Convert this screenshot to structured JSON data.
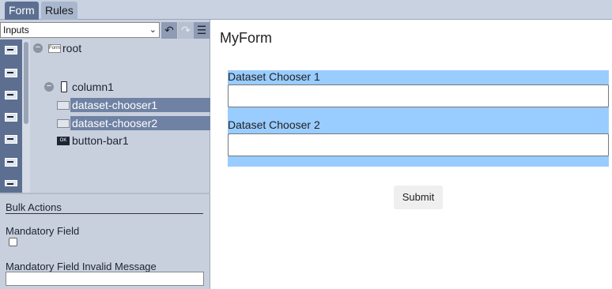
{
  "tabs": [
    {
      "label": "Form",
      "active": true
    },
    {
      "label": "Rules",
      "active": false
    }
  ],
  "left_panel": {
    "select": {
      "value": "Inputs",
      "options": [
        "Inputs"
      ]
    },
    "toolbar_icons": [
      "undo-icon",
      "redo-icon",
      "menu-icon"
    ],
    "palette_icons": [
      "input-icon",
      "input-icon",
      "dataset-chooser-icon",
      "textarea-icon",
      "dropdown-icon",
      "select-icon",
      "button-icon"
    ],
    "tree": {
      "root": {
        "label": "root",
        "icon": "Form"
      },
      "column": {
        "label": "column1"
      },
      "items": [
        {
          "label": "dataset-chooser1",
          "selected": true
        },
        {
          "label": "dataset-chooser2",
          "selected": true
        },
        {
          "label": "button-bar1",
          "selected": false,
          "icon": "OK"
        }
      ]
    },
    "bulk": {
      "title": "Bulk Actions",
      "mandatory_label": "Mandatory Field",
      "mandatory_checked": false,
      "invalid_label": "Mandatory Field Invalid Message",
      "invalid_value": ""
    }
  },
  "form": {
    "title": "MyForm",
    "fields": [
      {
        "label": "Dataset Chooser 1",
        "value": ""
      },
      {
        "label": "Dataset Chooser 2",
        "value": ""
      }
    ],
    "submit_label": "Submit"
  },
  "colors": {
    "tab_active": "#5c6f91",
    "panel_bg": "#c8d0de",
    "selection": "#6f82a3",
    "field_highlight": "#99ccff"
  }
}
